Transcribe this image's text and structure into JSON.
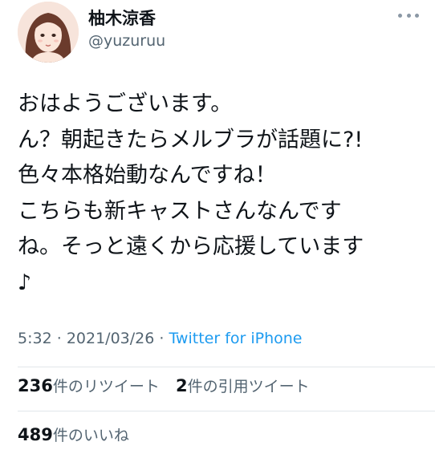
{
  "user": {
    "display_name": "柚木涼香",
    "handle": "@yuzuruu"
  },
  "tweet": {
    "lines": [
      "おはようございます。",
      "ん？朝起きたらメルブラが話題に?!",
      "色々本格始動なんですね！",
      "こちらも新キャストさんなんです",
      "ね。そっと遠くから応援しています",
      "♪"
    ],
    "time": "5:32",
    "date": "2021/03/26",
    "separator": "·",
    "source": "Twitter for iPhone"
  },
  "stats": {
    "retweets_count": "236",
    "retweets_label": "件のリツイート",
    "quotes_count": "2",
    "quotes_label": "件の引用ツイート",
    "likes_count": "489",
    "likes_label": "件のいいね"
  },
  "icons": {
    "more": "more-horizontal-icon"
  },
  "colors": {
    "link": "#1d9bf0",
    "secondary_text": "#536471",
    "primary_text": "#0f1419"
  }
}
